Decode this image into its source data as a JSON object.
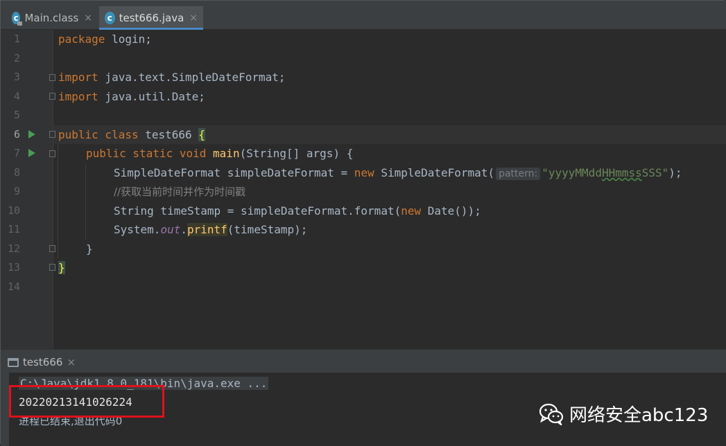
{
  "tabs": [
    {
      "label": "Main.class",
      "close": "×",
      "icon": "class-file-icon"
    },
    {
      "label": "test666.java",
      "close": "×",
      "icon": "java-class-icon"
    }
  ],
  "editor": {
    "line_numbers": [
      "1",
      "2",
      "3",
      "4",
      "5",
      "6",
      "7",
      "8",
      "9",
      "10",
      "11",
      "12",
      "13",
      "14"
    ],
    "lines": {
      "l1_kw": "package",
      "l1_rest": " login;",
      "l3_kw": "import",
      "l3_rest": " java.text.SimpleDateFormat;",
      "l4_kw": "import",
      "l4_rest": " java.util.Date;",
      "l6_kw1": "public",
      "l6_kw2": " class",
      "l6_name": " test666 ",
      "l6_brace": "{",
      "l7_kw1": "public",
      "l7_kw2": " static",
      "l7_kw3": " void",
      "l7_fn": " main",
      "l7_rest": "(String[] args) {",
      "l8_a": "SimpleDateFormat simpleDateFormat = ",
      "l8_kw": "new",
      "l8_b": " SimpleDateFormat(",
      "l8_hint": "pattern:",
      "l8_q1": "\"yyyyMMdd",
      "l8_sq": "HHmmss",
      "l8_q2": "SSS\"",
      "l8_end": ");",
      "l9_comment": "//获取当前时间并作为时间戳",
      "l10_a": "String timeStamp = simpleDateFormat.format(",
      "l10_kw": "new",
      "l10_b": " Date());",
      "l11_a": "System.",
      "l11_out": "out",
      "l11_dot": ".",
      "l11_fn": "printf",
      "l11_b": "(timeStamp);",
      "l12": "}",
      "l13": "}"
    }
  },
  "run_panel": {
    "tab_label": "test666",
    "close": "×",
    "command": "C:\\Java\\jdk1.8.0_181\\bin\\java.exe ...",
    "output": "20220213141026224",
    "exit_message": "进程已结束,退出代码0"
  },
  "watermark": {
    "text": "网络安全abc123",
    "icon": "wechat-icon"
  },
  "colors": {
    "keyword": "#cc7832",
    "string": "#6a8759",
    "function": "#ffc66d",
    "highlight_box": "#e0111b",
    "run_arrow": "#499c54"
  }
}
